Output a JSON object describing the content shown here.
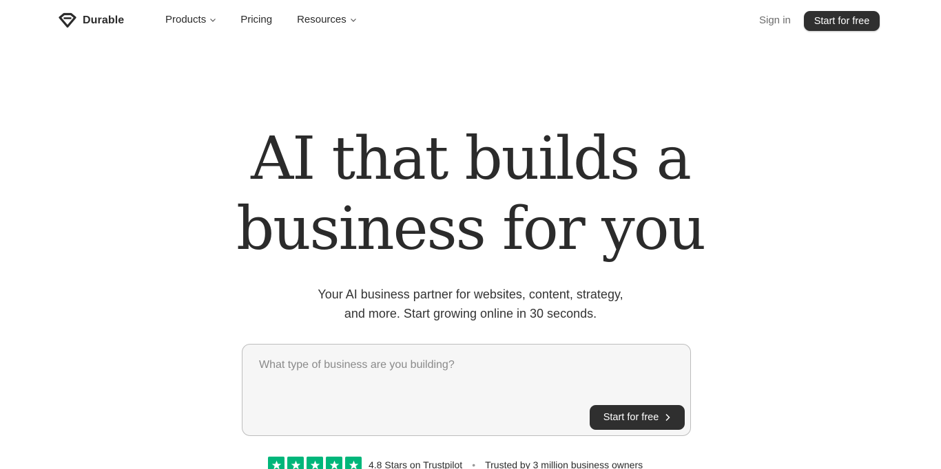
{
  "brand": {
    "name": "Durable",
    "logo_icon": "durable-logo-icon"
  },
  "nav": {
    "products": "Products",
    "pricing": "Pricing",
    "resources": "Resources",
    "sign_in": "Sign in",
    "cta": "Start for free"
  },
  "hero": {
    "title_line1": "AI that builds a",
    "title_line2": "business for you",
    "subtitle_line1": "Your AI business partner for websites, content, strategy,",
    "subtitle_line2": "and more. Start growing online in 30 seconds."
  },
  "prompt": {
    "placeholder": "What type of business are you building?",
    "cta": "Start for free"
  },
  "trust": {
    "rating_text": "4.8 Stars on Trustpilot",
    "stars": 5,
    "separator": "•",
    "trusted_text": "Trusted by 3 million business owners"
  },
  "colors": {
    "text": "#2b2b2b",
    "button": "#2f2f2f",
    "trustpilot_green": "#00b67a",
    "input_bg": "#f6f6f6"
  }
}
